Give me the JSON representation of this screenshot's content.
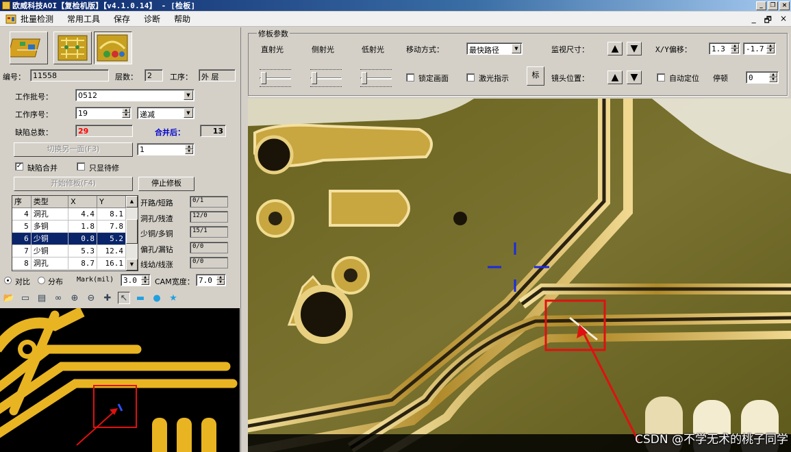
{
  "window": {
    "title": "欧威科技AOI【复检机版】【v4.1.0.14】 - [检板]"
  },
  "menu": {
    "items": [
      "批量检测",
      "常用工具",
      "保存",
      "诊断",
      "帮助"
    ],
    "mdi_controls": [
      "_",
      "🗗",
      "×"
    ]
  },
  "board": {
    "id_label": "编号：",
    "id_value": "11558",
    "layers_label": "层数：",
    "layers_value": "2",
    "process_label": "工序：",
    "process_value": "外  层"
  },
  "form": {
    "batch_label": "工作批号：",
    "batch_value": "0512",
    "seq_label": "工作序号：",
    "seq_value": "19",
    "order_value": "递减",
    "defects_label": "缺陷总数：",
    "defects_value": "29",
    "merged_label": "合并后：",
    "merged_value": "13",
    "switch_button": "切换另一面(F3)",
    "switch_value": "1",
    "merge_checkbox": "缺陷合并",
    "merge_checked": true,
    "pending_checkbox": "只显待修",
    "pending_checked": false,
    "start_repair_button": "开始修板(F4)",
    "stop_repair_button": "停止修板"
  },
  "defect_table": {
    "columns": [
      "序",
      "类型",
      "X",
      "Y"
    ],
    "rows": [
      {
        "no": "4",
        "type": "洞孔",
        "x": "4.4",
        "y": "8.1",
        "selected": false
      },
      {
        "no": "5",
        "type": "多铜",
        "x": "1.8",
        "y": "7.8",
        "selected": false
      },
      {
        "no": "6",
        "type": "少铜",
        "x": "0.8",
        "y": "5.2",
        "selected": true
      },
      {
        "no": "7",
        "type": "少铜",
        "x": "5.3",
        "y": "12.4",
        "selected": false
      },
      {
        "no": "8",
        "type": "洞孔",
        "x": "8.7",
        "y": "16.1",
        "selected": false
      }
    ]
  },
  "stats": [
    {
      "label": "开路/短路",
      "value": "0/1"
    },
    {
      "label": "洞孔/残渣",
      "value": "12/0"
    },
    {
      "label": "少铜/多铜",
      "value": "15/1"
    },
    {
      "label": "偏孔/漏钻",
      "value": "0/0"
    },
    {
      "label": "线幼/线涨",
      "value": "0/0"
    }
  ],
  "view_mode": {
    "compare_label": "对比",
    "distribution_label": "分布",
    "mark_label": "Mark(mil)",
    "mark_value": "3.0",
    "cam_width_label": "CAM宽度：",
    "cam_width_value": "7.0"
  },
  "toolbar_icons": [
    "open-icon",
    "scan-icon",
    "print-icon",
    "glasses-icon",
    "zoom-in-icon",
    "zoom-out-icon",
    "crosshair-icon",
    "pointer-icon",
    "rect-icon",
    "circle-icon",
    "star-icon"
  ],
  "repair_params": {
    "group_title": "修板参数",
    "direct_light": "直射光",
    "side_light": "侧射光",
    "low_light": "低射光",
    "move_mode_label": "移动方式：",
    "move_mode_value": "最快路径",
    "monitor_size_label": "监视尺寸：",
    "offset_label": "X/Y偏移：",
    "offset_x": "1.3",
    "offset_y": "-1.7",
    "lock_screen_label": "锁定画面",
    "laser_label": "激光指示",
    "mark_button": "标",
    "lens_pos_label": "镜头位置：",
    "auto_locate_label": "自动定位",
    "pause_label": "停顿",
    "pause_value": "0"
  },
  "watermark": "CSDN @不学无术的桃子同学",
  "colors": {
    "selection": "#0a246a",
    "defect_count": "#ff0000",
    "merged_label": "#0000cc",
    "annotation": "#e01010",
    "cam_trace": "#e8b422"
  }
}
